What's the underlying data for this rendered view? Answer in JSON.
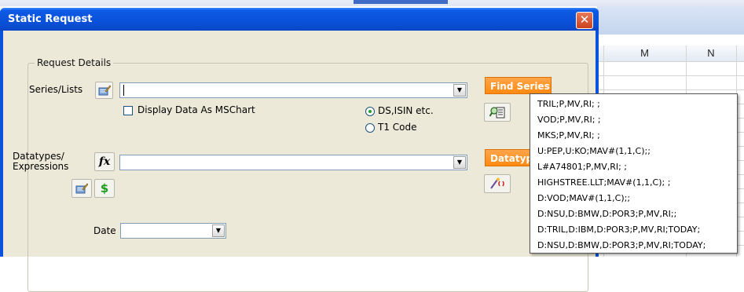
{
  "dialog": {
    "title": "Static Request",
    "close_glyph": "✕"
  },
  "request_details": {
    "group_label": "Request Details",
    "series_label": "Series/Lists",
    "series_value": "",
    "display_chart_label": "Display Data As MSChart",
    "display_chart_checked": false,
    "radio_ds_label": "DS,ISIN etc.",
    "radio_t1_label": "T1 Code",
    "radio_selected": "DS,ISIN etc.",
    "datatypes_label_line1": "Datatypes/",
    "datatypes_label_line2": "Expressions",
    "datatypes_value": "",
    "date_label": "Date",
    "date_value": "",
    "find_series_label": "Find Series",
    "datatypes_button_label": "Datatypes",
    "fx_glyph": "fx",
    "dollar_glyph": "$"
  },
  "spreadsheet": {
    "columns": [
      "M",
      "N"
    ]
  },
  "popup_list": {
    "items": [
      "TRIL;P,MV,RI; ;",
      "VOD;P,MV,RI; ;",
      "MKS;P,MV,RI; ;",
      "U:PEP,U:KO;MAV#(1,1,C);;",
      "L#A74801;P,MV,RI; ;",
      "HIGHSTREE.LLT;MAV#(1,1,C); ;",
      "D:VOD;MAV#(1,1,C);;",
      "D:NSU,D:BMW,D:POR3;P,MV,RI;;",
      "D:TRIL,D:IBM,D:POR3;P,MV,RI;TODAY;",
      "D:NSU,D:BMW,D:POR3;P,MV,RI;TODAY;"
    ]
  },
  "colors": {
    "titlebar": "#0a4fd6",
    "accent_orange": "#ff8a10",
    "dialog_face": "#ece9d8"
  }
}
